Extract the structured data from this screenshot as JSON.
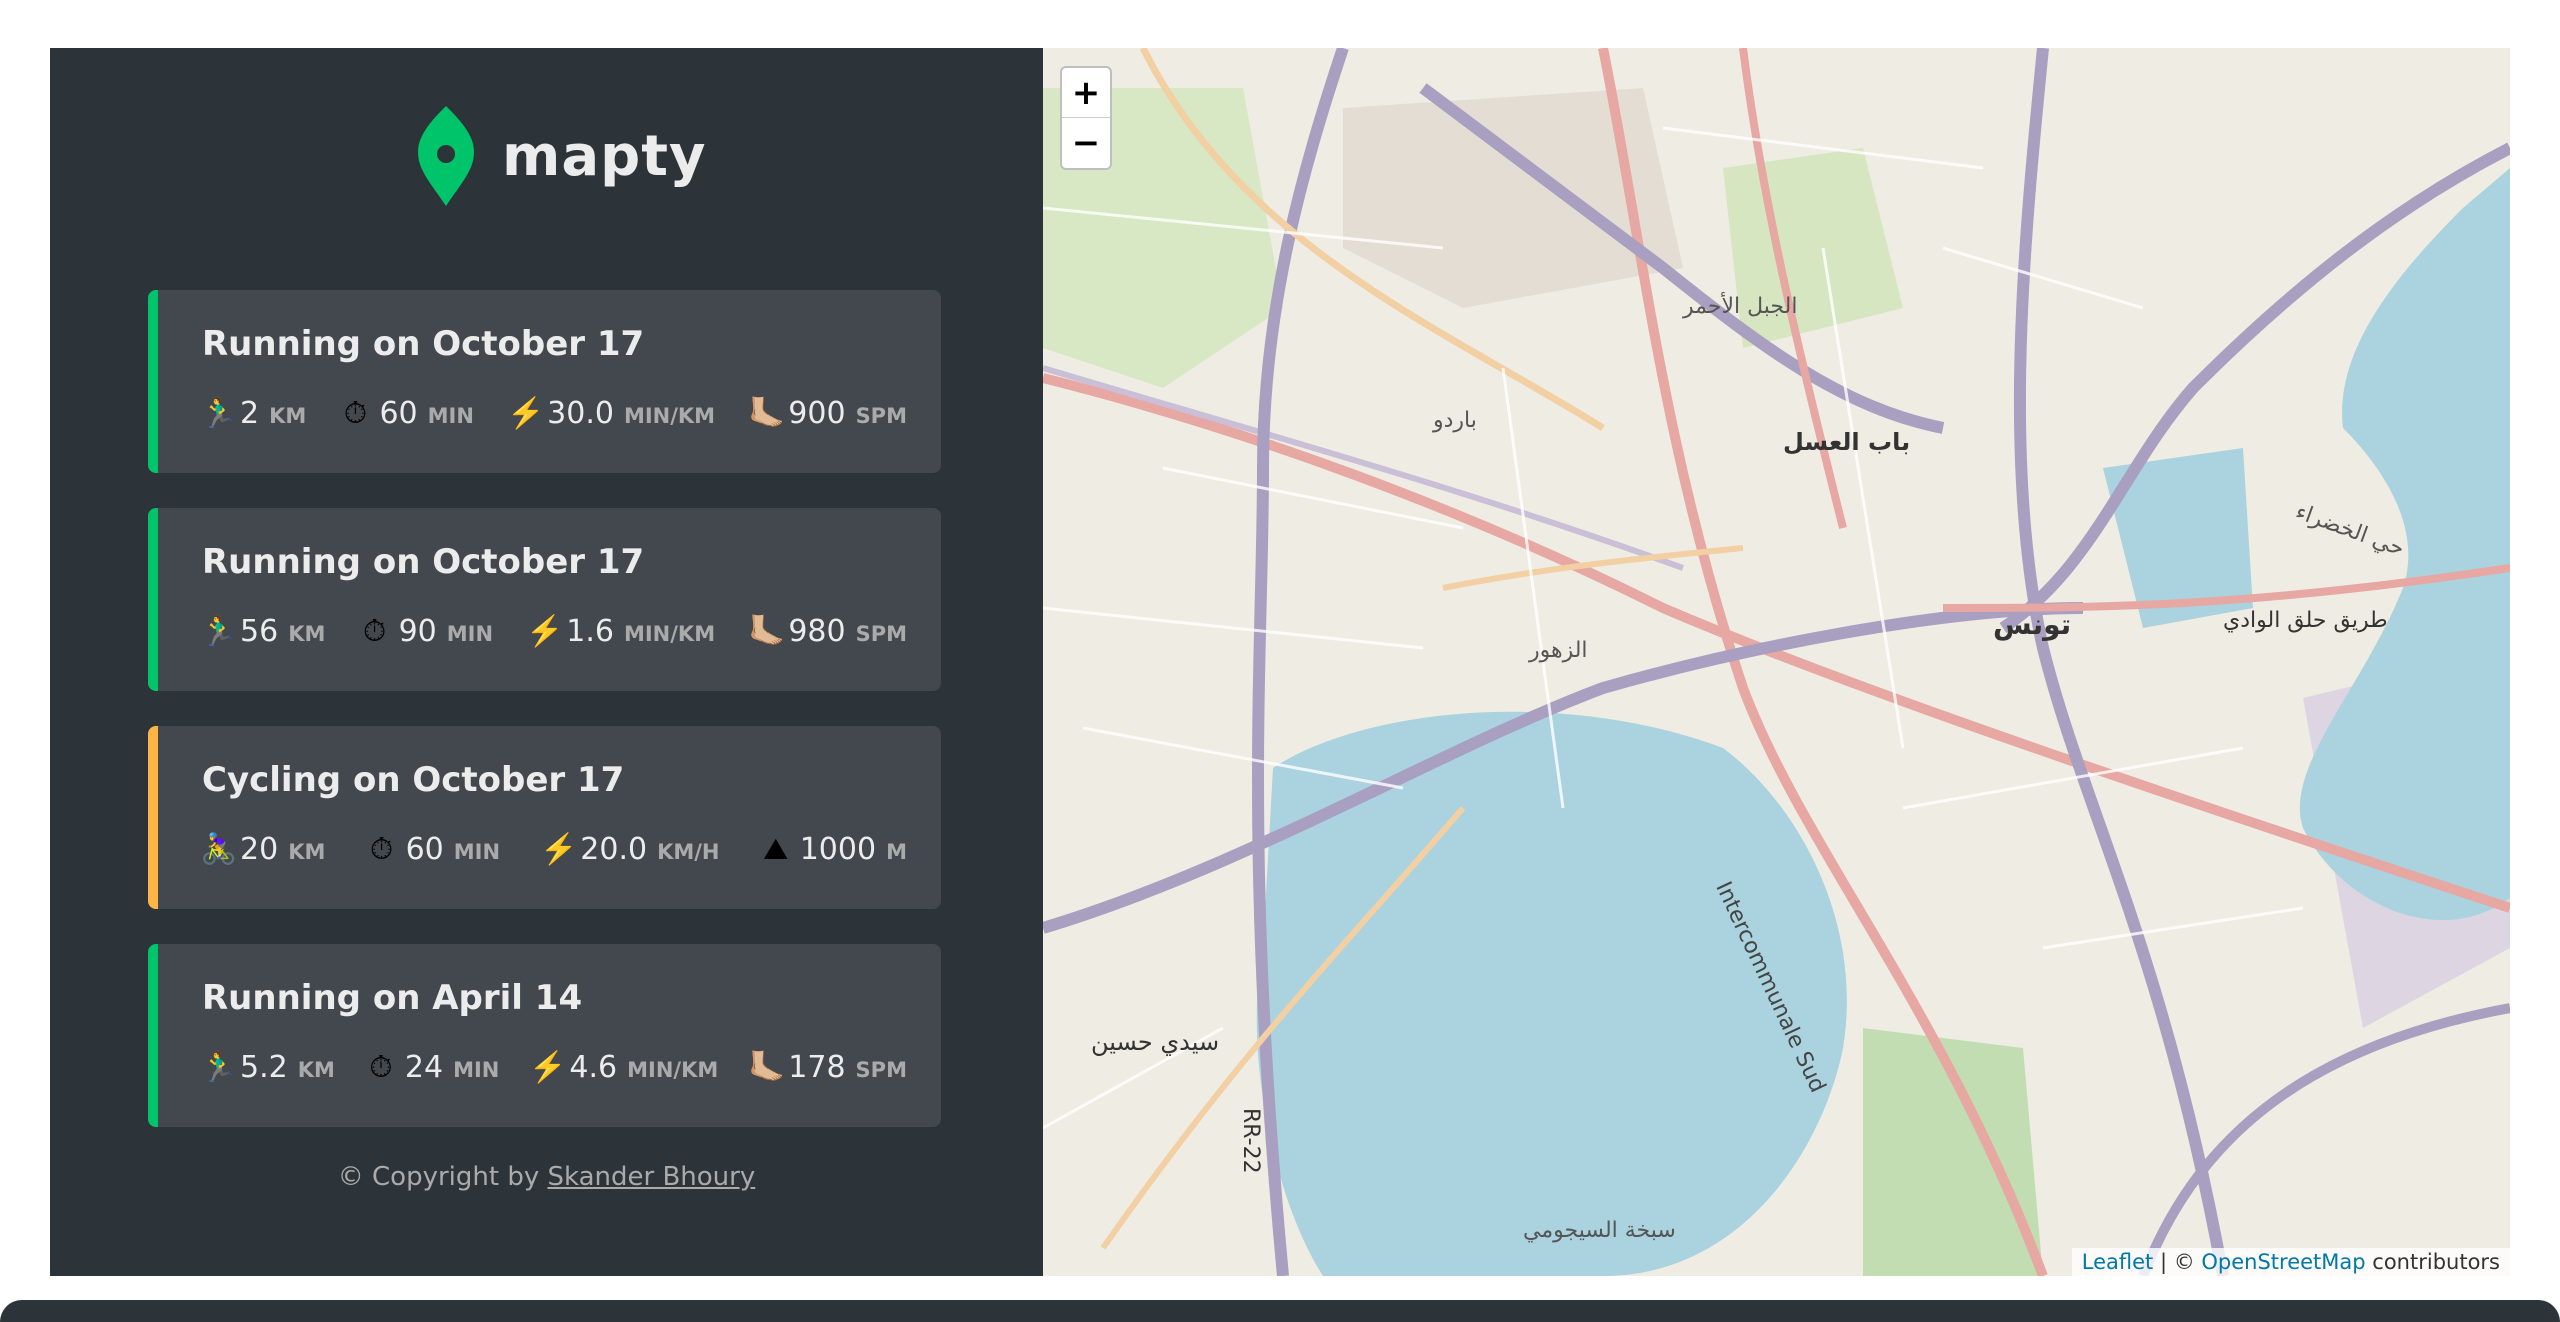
{
  "app": {
    "name": "mapty",
    "brand_color": "#00c46a"
  },
  "workouts": [
    {
      "title": "Running on October 17",
      "type": "running",
      "accent": "#00c46a",
      "details": [
        {
          "icon": "🏃‍♂️",
          "value": "2",
          "unit": "km"
        },
        {
          "icon": "⏱",
          "value": "60",
          "unit": "min"
        },
        {
          "icon": "⚡️",
          "value": "30.0",
          "unit": "min/km"
        },
        {
          "icon": "🦶🏼",
          "value": "900",
          "unit": "spm"
        }
      ]
    },
    {
      "title": "Running on October 17",
      "type": "running",
      "accent": "#00c46a",
      "details": [
        {
          "icon": "🏃‍♂️",
          "value": "56",
          "unit": "km"
        },
        {
          "icon": "⏱",
          "value": "90",
          "unit": "min"
        },
        {
          "icon": "⚡️",
          "value": "1.6",
          "unit": "min/km"
        },
        {
          "icon": "🦶🏼",
          "value": "980",
          "unit": "spm"
        }
      ]
    },
    {
      "title": "Cycling on October 17",
      "type": "cycling",
      "accent": "#ffb545",
      "details": [
        {
          "icon": "🚴‍♀️",
          "value": "20",
          "unit": "km"
        },
        {
          "icon": "⏱",
          "value": "60",
          "unit": "min"
        },
        {
          "icon": "⚡️",
          "value": "20.0",
          "unit": "km/h"
        },
        {
          "icon": "⛰",
          "value": "1000",
          "unit": "m"
        }
      ]
    },
    {
      "title": "Running on April 14",
      "type": "running",
      "accent": "#00c46a",
      "details": [
        {
          "icon": "🏃‍♂️",
          "value": "5.2",
          "unit": "km"
        },
        {
          "icon": "⏱",
          "value": "24",
          "unit": "min"
        },
        {
          "icon": "⚡️",
          "value": "4.6",
          "unit": "min/km"
        },
        {
          "icon": "🦶🏼",
          "value": "178",
          "unit": "spm"
        }
      ]
    }
  ],
  "footer": {
    "prefix": "© Copyright by ",
    "author": "Skander Bhoury"
  },
  "map": {
    "zoom_in": "+",
    "zoom_out": "−",
    "attribution": {
      "leaflet": "Leaflet",
      "separator": " | © ",
      "osm": "OpenStreetMap",
      "suffix": " contributors"
    },
    "labels": [
      "تونس",
      "باب العسل",
      "باردو",
      "سيدي حسين",
      "Intercommunale Sud",
      "سبخة السيجومي",
      "الزهور",
      "الجبل الأحمر",
      "حي الخضراء",
      "طريق حلق الوادي",
      "RR-22"
    ]
  }
}
